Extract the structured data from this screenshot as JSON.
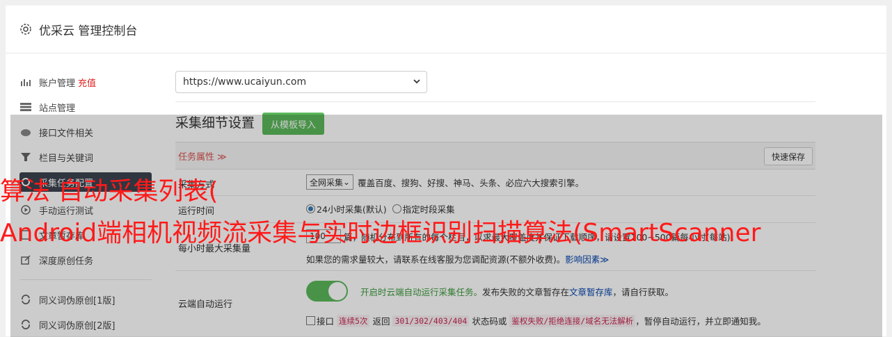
{
  "app": {
    "title": "优采云 管理控制台",
    "icon": "gear-icon"
  },
  "sidebar": {
    "items": [
      {
        "label": "账户管理",
        "badge": "充值",
        "icon": "bar-chart-icon"
      },
      {
        "label": "站点管理",
        "icon": "server-icon"
      },
      {
        "label": "接口文件相关",
        "icon": "cloud-upload-icon"
      },
      {
        "label": "栏目与关键词",
        "icon": "filter-icon"
      },
      {
        "label": "采集任务配置",
        "icon": "gear-icon",
        "active": true
      },
      {
        "label": "手动运行测试",
        "icon": "play-circle-icon"
      },
      {
        "label": "文章暂存库",
        "icon": "list-icon"
      },
      {
        "label": "深度原创任务",
        "icon": "edit-icon"
      },
      {
        "label": "同义词伪原创[1版]",
        "icon": "refresh-icon"
      },
      {
        "label": "同义词伪原创[2版]",
        "icon": "refresh-icon"
      }
    ]
  },
  "main": {
    "site_select": {
      "value": "https://www.ucaiyun.com"
    },
    "section_title": "采集细节设置",
    "import_button": "从模板导入",
    "task_attr": "任务属性 ≫",
    "quick_save": "快速保存",
    "rows": {
      "mode": {
        "label": "采集方式",
        "select": "全网采集",
        "desc": "覆盖百度、搜狗、好搜、神马、头条、必应六大搜索引擎。"
      },
      "time": {
        "label": "运行时间",
        "opt1": "24小时采集(默认)",
        "opt2": "指定时段采集"
      },
      "max": {
        "label": "每小时最大采集量",
        "value": "100",
        "line1": "篇，随机分布到所有的每个栏目，以求最大覆盖度并保证下载顺序，请设置100~500篇每小时(每站)，",
        "line2a": "如果您的需求量较大，请联系在线客服为您调配资源(不额外收费)。",
        "line2b": "影响因素≫"
      },
      "cloud": {
        "label": "云端自动运行",
        "line1a": "开启时云端自动运行采集任务。",
        "line1b": "发布失败的文章暂存在",
        "line1c": "文章暂存库",
        "line1d": "，请自行获取。",
        "chk": "接口",
        "code1": "连续5次",
        "t1": "返回",
        "code2": "301/302/403/404",
        "t2": "状态码或",
        "code3": "鉴权失败/拒绝连接/域名无法解析",
        "t3": "，暂停自动运行，并立即通知我。"
      }
    }
  },
  "watermark": {
    "line1": "算法 自动采集列表(",
    "line2": "Android端相机视频流采集与实时边框识别扫描算法(SmartScanner"
  },
  "colors": {
    "accent_green": "#5cb85c",
    "active_bg": "#3d4450",
    "danger": "#e02020",
    "watermark": "#ff1a1a"
  }
}
